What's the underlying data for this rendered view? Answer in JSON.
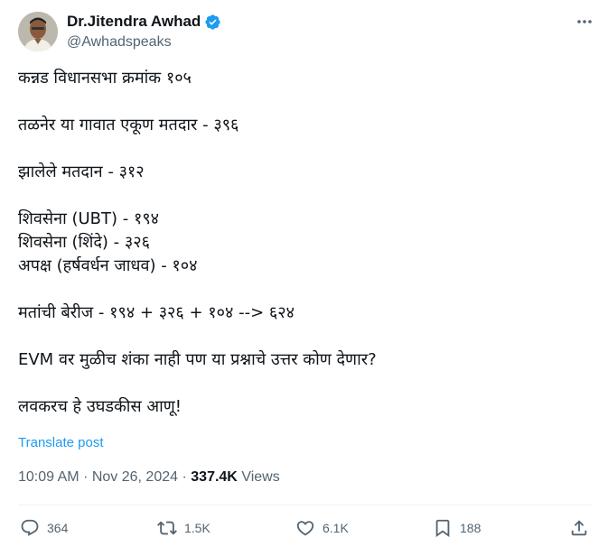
{
  "author": {
    "name": "Dr.Jitendra Awhad",
    "handle": "@Awhadspeaks",
    "verified": true
  },
  "tweet": {
    "lines": [
      "कन्नड विधानसभा क्रमांक १०५",
      "",
      "तळनेर या गावात एकूण मतदार - ३९६",
      "",
      "झालेले मतदान - ३१२",
      "",
      "शिवसेना (UBT) - १९४",
      "शिवसेना (शिंदे) - ३२६",
      "अपक्ष (हर्षवर्धन जाधव) - १०४",
      "",
      "मतांची बेरीज - १९४ + ३२६ + १०४ --> ६२४",
      "",
      "EVM वर मुळीच शंका नाही पण या प्रश्नाचे उत्तर कोण देणार?",
      "",
      "लवकरच हे उघडकीस आणू!"
    ],
    "translate_label": "Translate post",
    "time": "10:09 AM",
    "separator": "·",
    "date": "Nov 26, 2024",
    "views_count": "337.4K",
    "views_label": "Views"
  },
  "actions": {
    "replies": "364",
    "reposts": "1.5K",
    "likes": "6.1K",
    "bookmarks": "188"
  },
  "icons": {
    "more": "more-icon",
    "verified": "verified-badge-icon",
    "reply": "reply-icon",
    "repost": "repost-icon",
    "like": "like-icon",
    "bookmark": "bookmark-icon",
    "share": "share-icon"
  },
  "colors": {
    "verified": "#1d9bf0",
    "link": "#1d9bf0",
    "secondary_text": "#536471"
  }
}
